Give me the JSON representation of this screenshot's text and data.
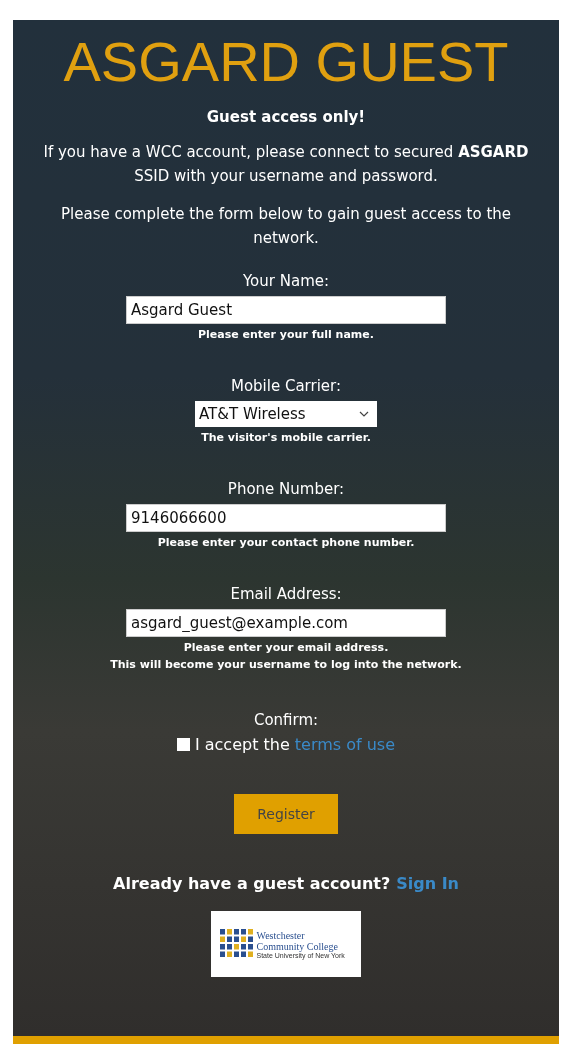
{
  "title": "ASGARD GUEST",
  "notice": "Guest access only!",
  "intro": "If you have a WCC account, please connect to secured **ASGARD** SSID with your username and password.",
  "instructions": "Please complete the form below to gain guest access to the network.",
  "fields": [
    {
      "kind": "text",
      "label": "Your Name:",
      "value": "Asgard Guest",
      "help": [
        "Please enter your full name."
      ]
    },
    {
      "kind": "select",
      "label": "Mobile Carrier:",
      "value": "AT&T Wireless",
      "help": [
        "The visitor's mobile carrier."
      ]
    },
    {
      "kind": "text",
      "label": "Phone Number:",
      "value": "9146066600",
      "help": [
        "Please enter your contact phone number."
      ]
    },
    {
      "kind": "text",
      "label": "Email Address:",
      "value": "asgard_guest@example.com",
      "help": [
        "Please enter your email address.",
        "This will become your username to log into the network."
      ]
    }
  ],
  "confirm": {
    "label": "Confirm:",
    "checked": false,
    "text": "I accept the",
    "link": "terms of use"
  },
  "register_button": "Register",
  "signin": {
    "text": "Already have a guest account?",
    "link": "Sign In"
  },
  "logo": {
    "name": "Westchester Community College",
    "tagline": "State University of New York"
  }
}
